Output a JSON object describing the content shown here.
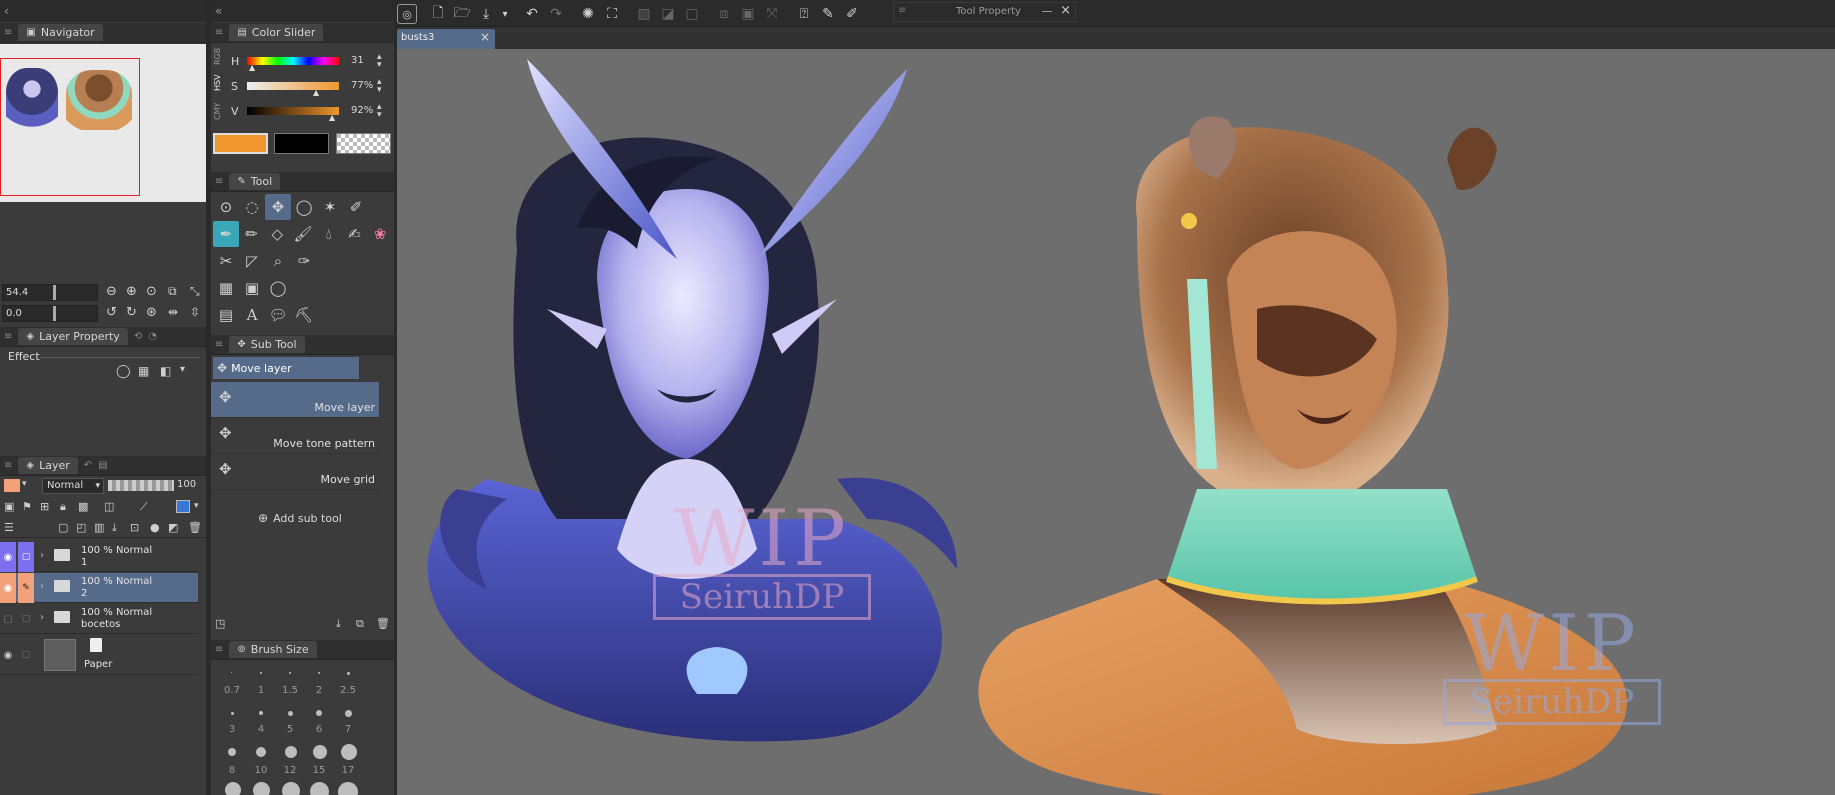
{
  "navigator": {
    "title": "Navigator"
  },
  "color_slider": {
    "title": "Color Slider",
    "modes": [
      "RGB",
      "HSV",
      "CMY"
    ],
    "h": {
      "label": "H",
      "value": "31"
    },
    "s": {
      "label": "S",
      "value": "77%"
    },
    "v": {
      "label": "V",
      "value": "92%"
    },
    "main_color": "#f0962e",
    "sub_color": "#000000"
  },
  "zoom": {
    "value": "54.4"
  },
  "rotate": {
    "value": "0.0"
  },
  "tool": {
    "title": "Tool"
  },
  "sub_tool": {
    "title": "Sub Tool",
    "group_label": "Move layer",
    "items": [
      {
        "label": "Move layer"
      },
      {
        "label": "Move tone pattern"
      },
      {
        "label": "Move grid"
      }
    ],
    "add_label": "Add sub tool"
  },
  "layer_property": {
    "title": "Layer Property",
    "effect_label": "Effect"
  },
  "layer": {
    "title": "Layer",
    "blend_mode": "Normal",
    "opacity": "100",
    "rows": [
      {
        "line1": "100 % Normal",
        "line2": "1"
      },
      {
        "line1": "100 % Normal",
        "line2": "2"
      },
      {
        "line1": "100 % Normal",
        "line2": "bocetos"
      },
      {
        "line1": "",
        "line2": "Paper"
      }
    ]
  },
  "brush_size": {
    "title": "Brush Size",
    "sizes": [
      "0.7",
      "1",
      "1.5",
      "2",
      "2.5",
      "3",
      "4",
      "5",
      "6",
      "7",
      "8",
      "10",
      "12",
      "15",
      "17"
    ]
  },
  "tool_property": {
    "title": "Tool Property"
  },
  "canvas": {
    "tab": "busts3",
    "watermark_line1": "WIP",
    "watermark_line2": "SeiruhDP"
  }
}
